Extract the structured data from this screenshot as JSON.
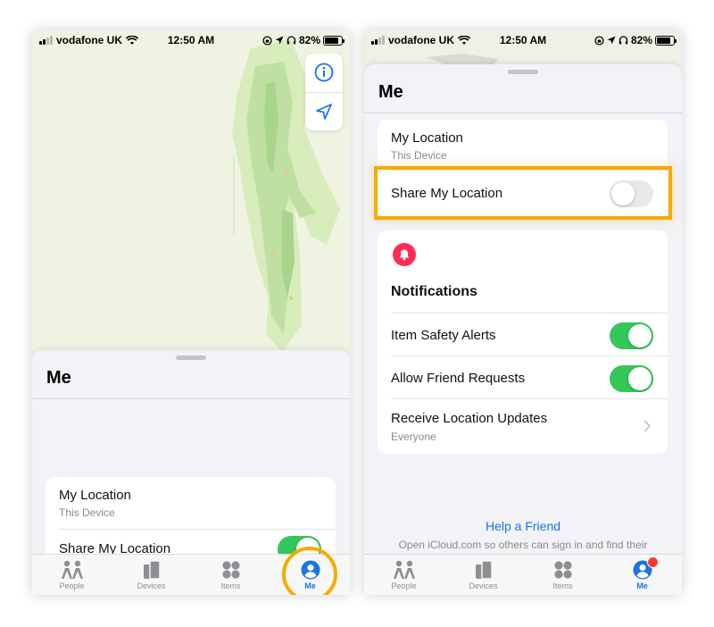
{
  "status_bar": {
    "carrier": "vodafone UK",
    "time": "12:50 AM",
    "battery": "82%",
    "battery_level": 0.82
  },
  "left_screen": {
    "sheet_title": "Me",
    "my_location_title": "My Location",
    "my_location_sub": "This Device",
    "share_location_label": "Share My Location",
    "share_location_on": true
  },
  "right_screen": {
    "sheet_title": "Me",
    "my_location_title": "My Location",
    "my_location_sub": "This Device",
    "share_location_label": "Share My Location",
    "share_location_on": false,
    "notifications_title": "Notifications",
    "item_safety_label": "Item Safety Alerts",
    "item_safety_on": true,
    "friend_requests_label": "Allow Friend Requests",
    "friend_requests_on": true,
    "location_updates_label": "Receive Location Updates",
    "location_updates_sub": "Everyone",
    "help_link": "Help a Friend",
    "help_text": "Open iCloud.com so others can sign in and find their devices from this iPhone."
  },
  "tabs": [
    {
      "label": "People",
      "icon": "people-icon"
    },
    {
      "label": "Devices",
      "icon": "devices-icon"
    },
    {
      "label": "Items",
      "icon": "items-icon"
    },
    {
      "label": "Me",
      "icon": "me-icon"
    }
  ],
  "colors": {
    "accent": "#1a73e8",
    "toggle_on": "#34c759",
    "highlight": "#f5ab00",
    "badge": "#ff3b30",
    "bell": "#ff2d55"
  }
}
